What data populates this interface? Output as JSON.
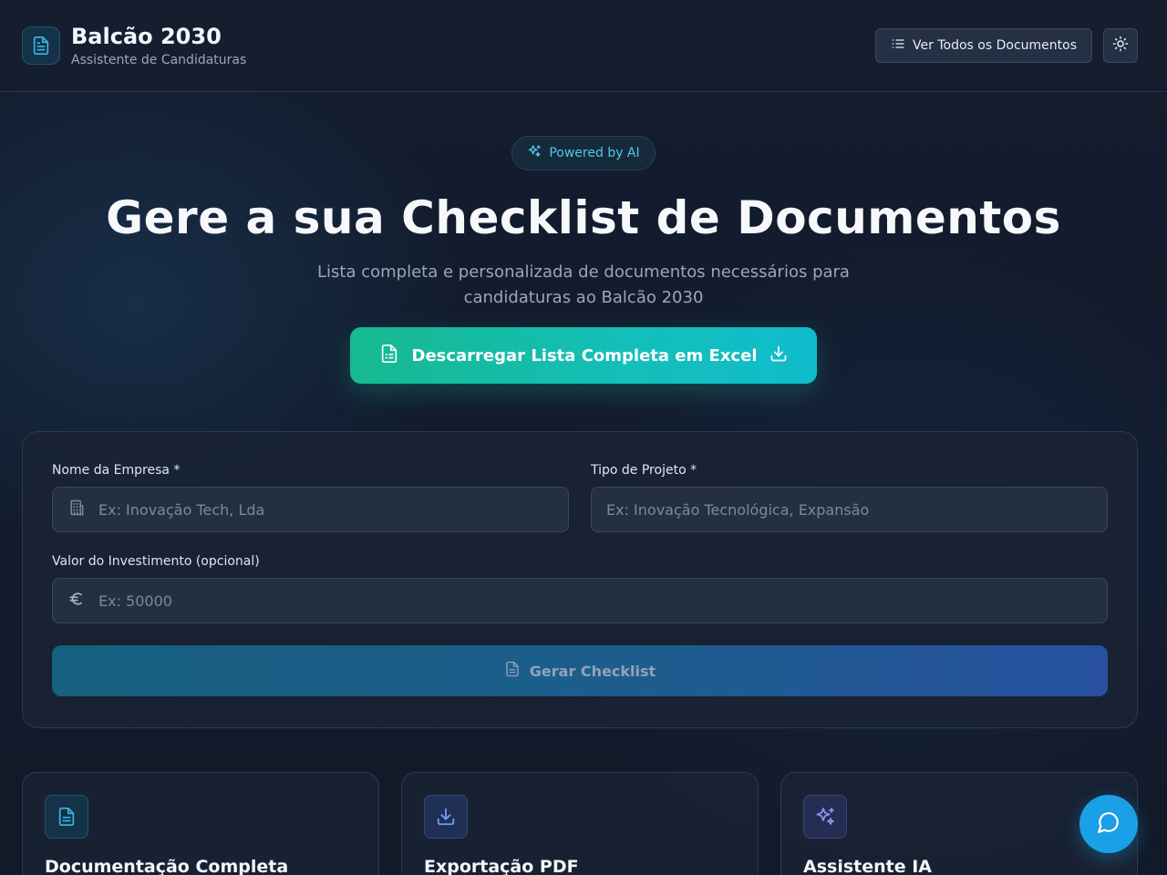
{
  "header": {
    "title": "Balcão 2030",
    "subtitle": "Assistente de Candidaturas",
    "docs_button_label": "Ver Todos os Documentos"
  },
  "hero": {
    "badge": "Powered by AI",
    "title": "Gere a sua Checklist de Documentos",
    "subtitle": "Lista completa e personalizada de documentos necessários para candidaturas ao Balcão 2030",
    "excel_button_label": "Descarregar Lista Completa em Excel"
  },
  "form": {
    "company": {
      "label": "Nome da Empresa *",
      "placeholder": "Ex: Inovação Tech, Lda",
      "value": ""
    },
    "project_type": {
      "label": "Tipo de Projeto *",
      "placeholder": "Ex: Inovação Tecnológica, Expansão",
      "value": ""
    },
    "investment": {
      "label": "Valor do Investimento (opcional)",
      "placeholder": "Ex: 50000",
      "value": ""
    },
    "submit_label": "Gerar Checklist"
  },
  "features": [
    {
      "title": "Documentação Completa",
      "icon": "file-text-icon",
      "color": "#2a9fd6"
    },
    {
      "title": "Exportação PDF",
      "icon": "download-icon",
      "color": "#5b8fe0"
    },
    {
      "title": "Assistente IA",
      "icon": "sparkles-icon",
      "color": "#7b7fe0"
    }
  ],
  "colors": {
    "accent_teal": "#13bfba",
    "accent_green": "#17b98f",
    "accent_blue": "#1aa0e6",
    "background": "#111a2b"
  }
}
